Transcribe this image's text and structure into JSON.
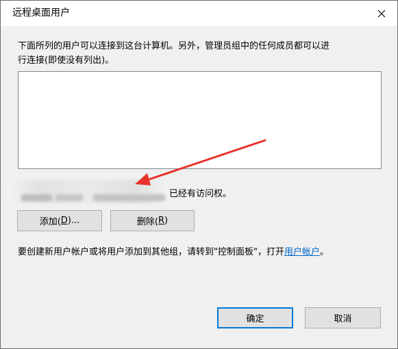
{
  "window": {
    "title": "远程桌面用户",
    "close_icon": "close-icon"
  },
  "intro": {
    "line1": "下面所列的用户可以连接到这台计算机。另外，管理员组中的任何成员都可以进",
    "line2": "行连接(即使没有列出)。"
  },
  "user_list": {
    "items": []
  },
  "access": {
    "suffix": "已经有访问权。"
  },
  "buttons": {
    "add": {
      "label": "添加(",
      "mnemonic": "D",
      "tail": ")..."
    },
    "remove": {
      "label": "删除(",
      "mnemonic": "R",
      "tail": ")"
    },
    "ok": "确定",
    "cancel": "取消"
  },
  "hint": {
    "before": "要创建新用户帐户或将用户添加到其他组，请转到\"控制面板\"，打开",
    "link": "用户帐户",
    "after": "。"
  },
  "annotation": {
    "arrow_color": "#e8322b"
  }
}
